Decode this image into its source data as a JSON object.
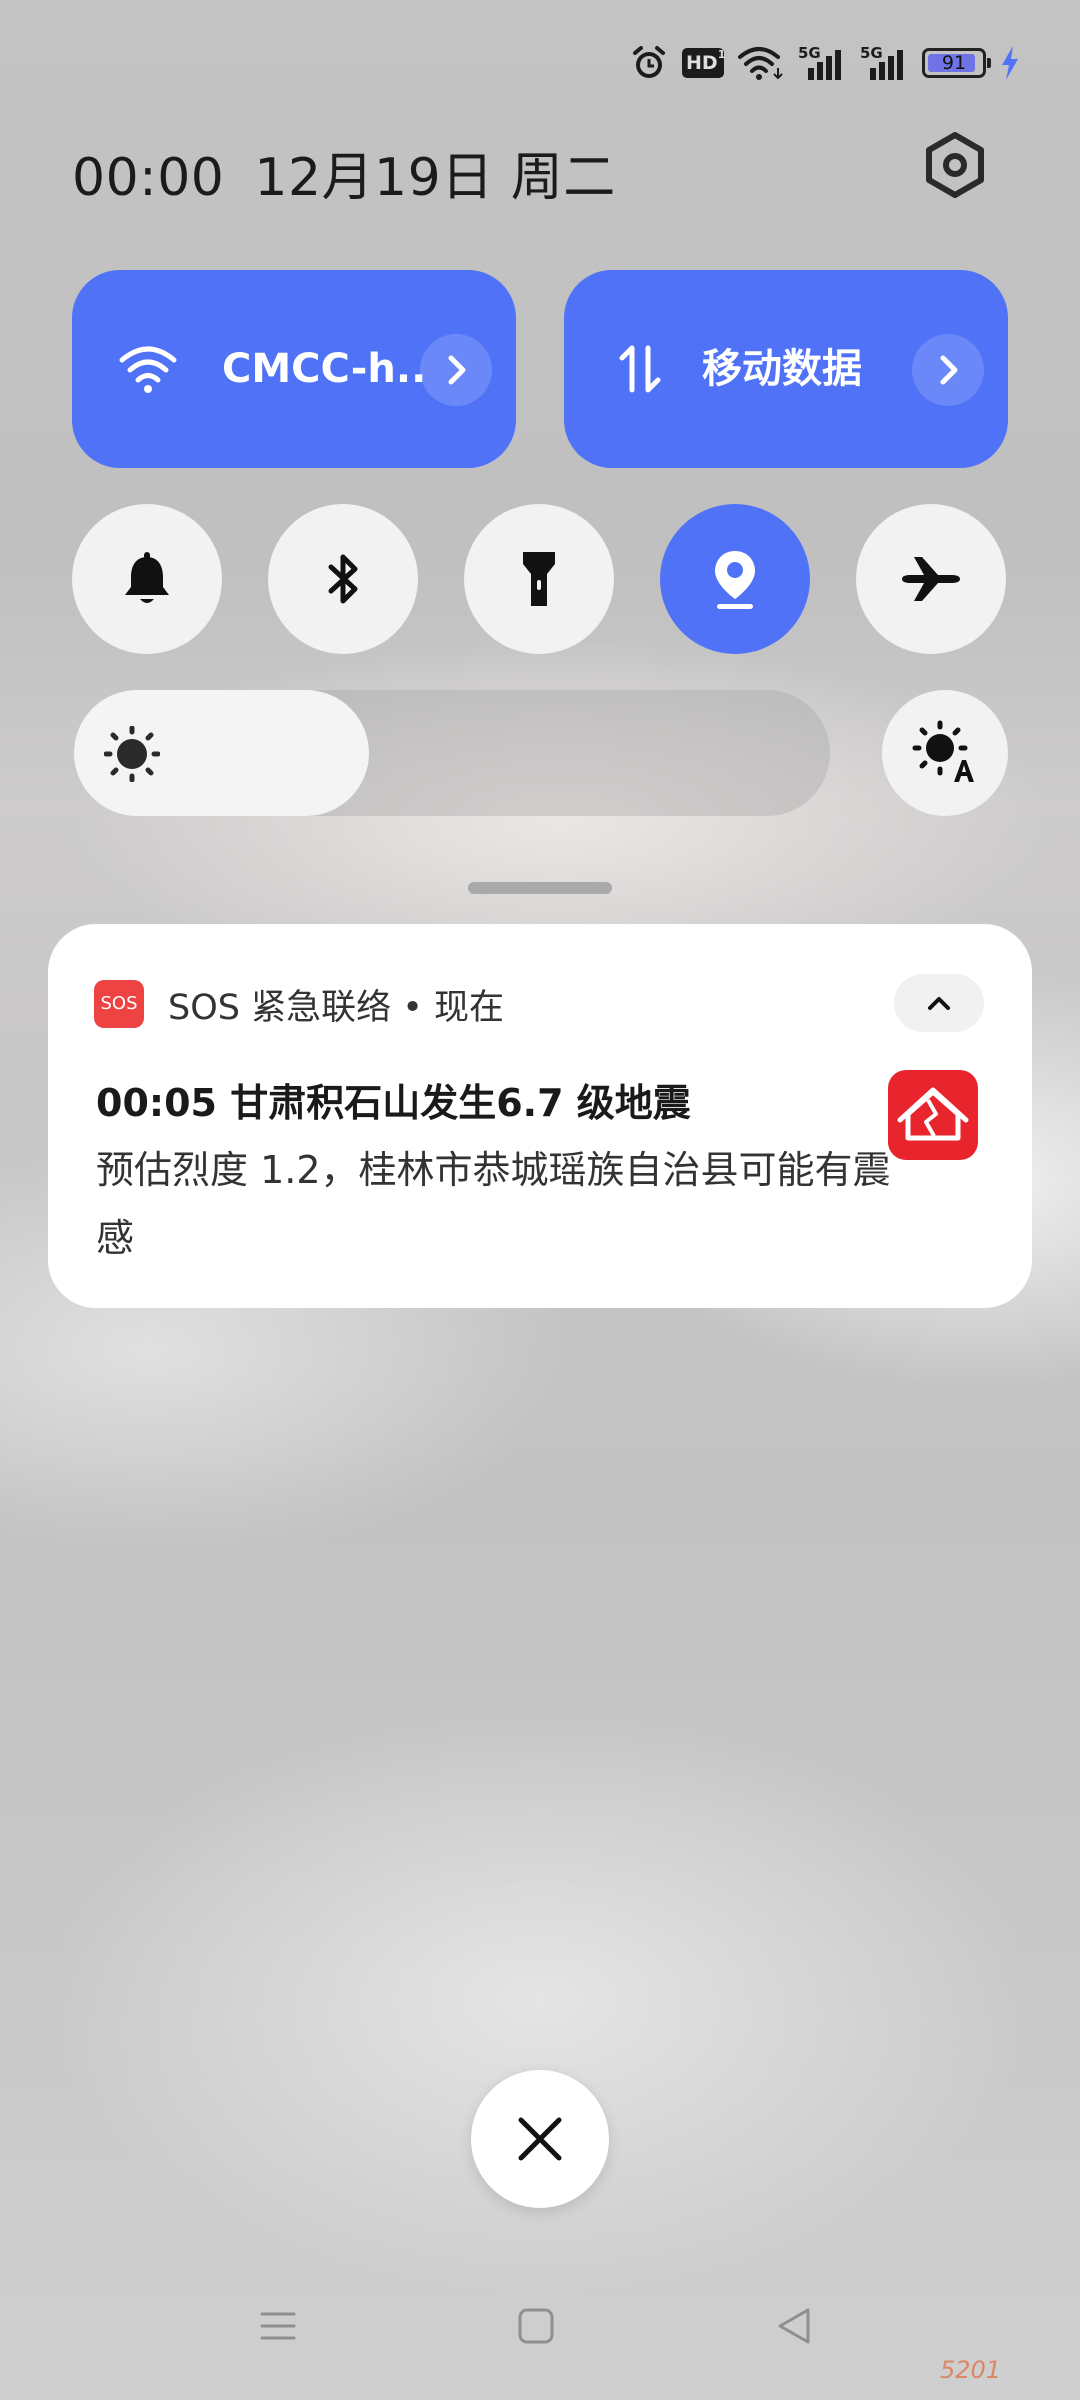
{
  "status_bar": {
    "icons": [
      "alarm-icon",
      "hd-voice-icon",
      "wifi-icon",
      "5g-signal-icon",
      "5g-signal-icon"
    ],
    "hd_text": "HD",
    "hd_sub": "1",
    "sim1_label": "5G",
    "sim2_label": "5G",
    "battery_percent": "91",
    "battery_level": 91,
    "charging": true
  },
  "header": {
    "time": "00:00",
    "date": "12月19日 周二"
  },
  "tiles": {
    "wifi": {
      "label": "CMCC-h..",
      "icon": "wifi-icon",
      "on": true
    },
    "mobile_data": {
      "label": "移动数据",
      "icon": "data-arrows-icon",
      "on": true
    }
  },
  "toggles": [
    {
      "name": "bell-icon",
      "on": false
    },
    {
      "name": "bluetooth-icon",
      "on": false
    },
    {
      "name": "flashlight-icon",
      "on": false
    },
    {
      "name": "location-icon",
      "on": true
    },
    {
      "name": "airplane-icon",
      "on": false
    }
  ],
  "brightness": {
    "level_percent": 39,
    "auto_icon": "auto-brightness-icon"
  },
  "notification": {
    "badge": "SOS",
    "app": "SOS 紧急联络 • 现在",
    "title": "00:05 甘肃积石山发生6.7 级地震",
    "body": "预估烈度 1.2，桂林市恭城瑶族自治县可能有震感",
    "icon": "earthquake-house-icon"
  },
  "watermark": "5201",
  "colors": {
    "accent": "#4f72f7",
    "sos_red": "#ee4343",
    "alert_red": "#e8242c"
  }
}
